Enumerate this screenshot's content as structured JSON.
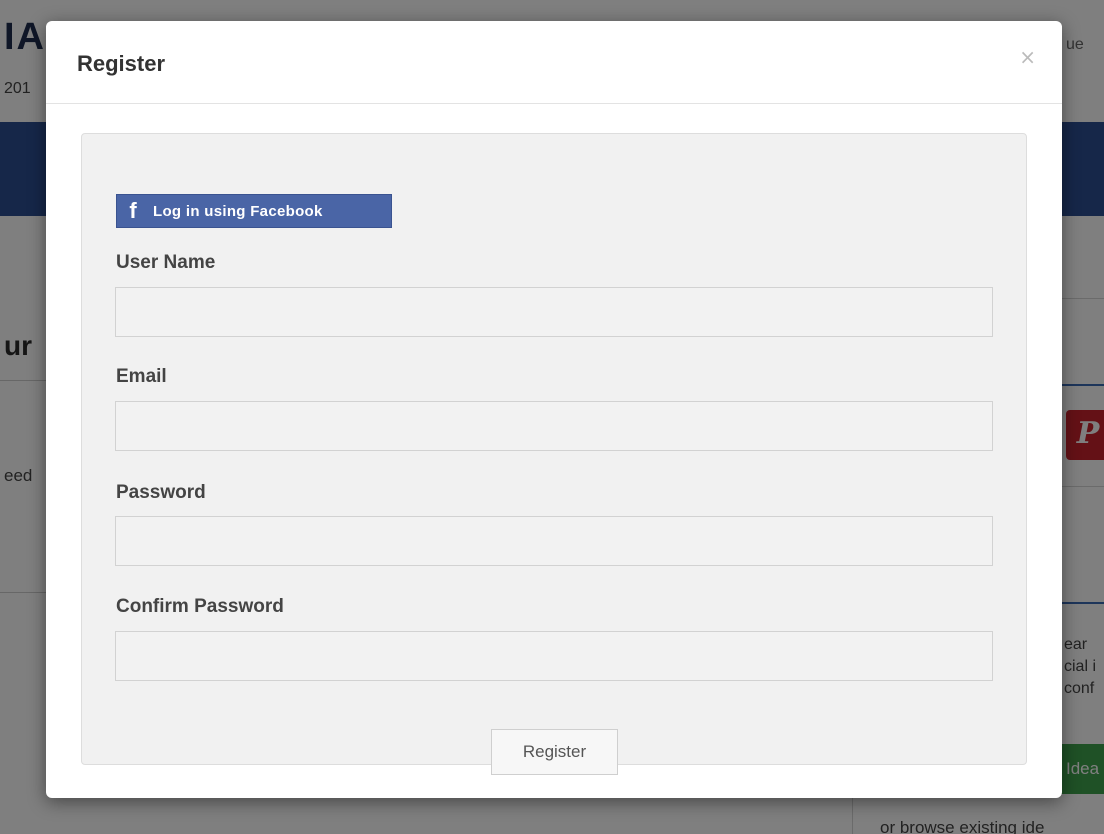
{
  "background": {
    "logo_text": "IA",
    "date_fragment": "201",
    "topright_fragment": "ue",
    "section_heading_fragment": "ur",
    "left_snippet_fragment": "eed",
    "right_snippet_lines": "ear\ncial i\nconf",
    "green_button_fragment": "Idea",
    "browse_fragment": "or browse existing ide"
  },
  "modal": {
    "title": "Register",
    "close_glyph": "×",
    "facebook_button": {
      "icon_glyph": "f",
      "label": "Log in using Facebook"
    },
    "fields": {
      "username": {
        "label": "User Name",
        "value": ""
      },
      "email": {
        "label": "Email",
        "value": ""
      },
      "password": {
        "label": "Password",
        "value": ""
      },
      "confirm_password": {
        "label": "Confirm Password",
        "value": ""
      }
    },
    "submit_label": "Register"
  },
  "colors": {
    "facebook_blue": "#4a65a6",
    "navbar_blue": "#2c4f93",
    "well_gray": "#f1f1f1"
  },
  "icons": {
    "close": "close-icon",
    "facebook": "facebook-icon",
    "pinterest": "pinterest-icon"
  }
}
